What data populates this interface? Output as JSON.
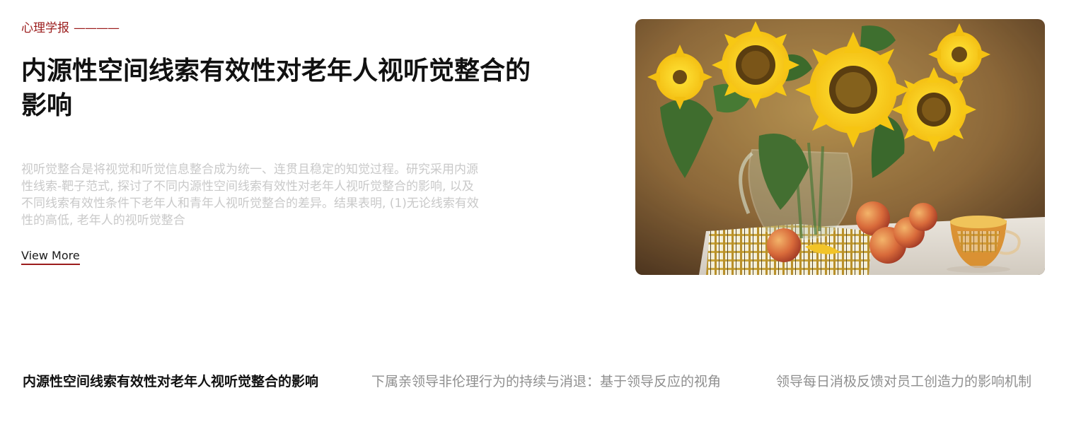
{
  "featured": {
    "source_label": "心理学报",
    "source_rule": "————",
    "title": "内源性空间线索有效性对老年人视听觉整合的影响",
    "summary": "视听觉整合是将视觉和听觉信息整合成为统一、连贯且稳定的知觉过程。研究采用内源性线索-靶子范式, 探讨了不同内源性空间线索有效性对老年人视听觉整合的影响, 以及不同线索有效性条件下老年人和青年人视听觉整合的差异。结果表明, (1)无论线索有效性的高低, 老年人的视听觉整合",
    "view_more_label": "View More",
    "image_subject": "sunflowers-still-life"
  },
  "tabs": [
    {
      "label": "内源性空间线索有效性对老年人视听觉整合的影响",
      "active": true
    },
    {
      "label": "下属亲领导非伦理行为的持续与消退：基于领导反应的视角",
      "active": false
    },
    {
      "label": "领导每日消极反馈对员工创造力的影响机制",
      "active": false
    }
  ],
  "colors": {
    "accent": "#9b1c1c",
    "title": "#111111",
    "summary": "#c9c9c9",
    "tab_inactive": "#8f8f8f"
  }
}
